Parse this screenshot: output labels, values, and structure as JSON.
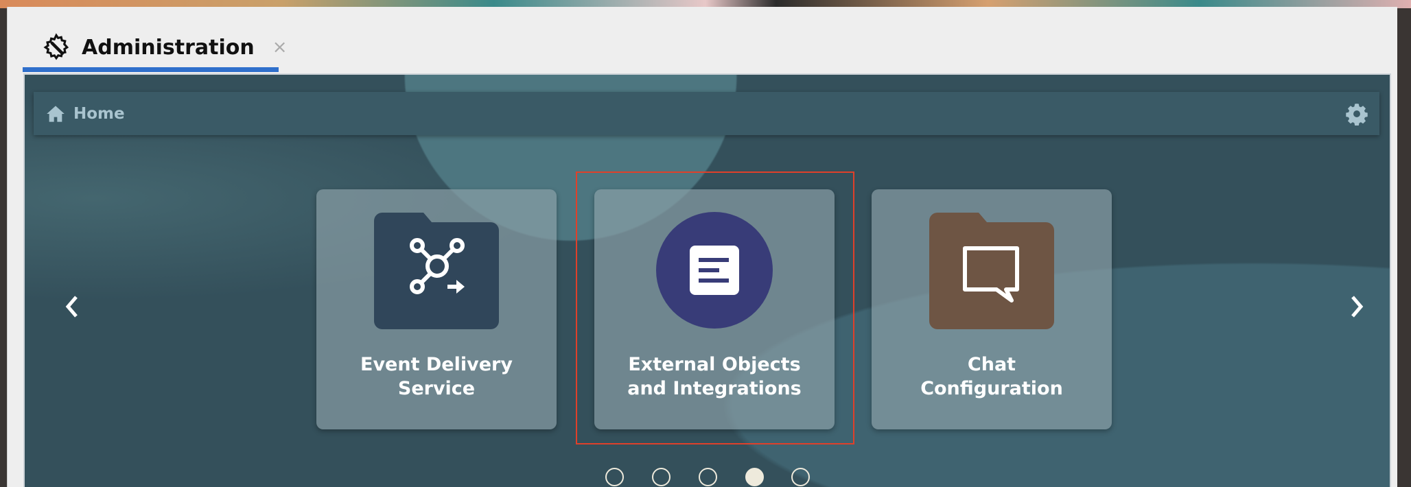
{
  "tab": {
    "title": "Administration",
    "close": "×",
    "icon": "wrench-gear-icon"
  },
  "header": {
    "breadcrumb": "Home",
    "home_icon": "home-icon",
    "settings_icon": "gear-icon"
  },
  "cards": [
    {
      "label": "Event Delivery Service",
      "icon": "event-network-folder-icon",
      "color": "#30465a"
    },
    {
      "label": "External Objects and Integrations",
      "icon": "document-circle-icon",
      "color": "#383c78",
      "selected": true
    },
    {
      "label": "Chat Configuration",
      "icon": "chat-bubble-folder-icon",
      "color": "#6e5544"
    }
  ],
  "carousel": {
    "pages": 5,
    "current": 4
  },
  "colors": {
    "accent": "#2f6fcb",
    "highlight": "#e0402a"
  }
}
